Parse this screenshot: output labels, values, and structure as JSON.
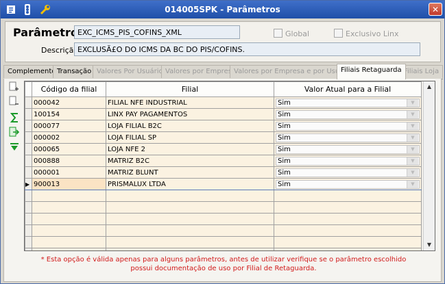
{
  "window": {
    "title": "014005SPK - Parâmetros",
    "close_label": "✕"
  },
  "toolbar": {
    "icons": [
      "menu-icon",
      "traffic-light-icon",
      "wrench-icon"
    ]
  },
  "form": {
    "parametro_label": "Parâmetro",
    "parametro_value": "EXC_ICMS_PIS_COFINS_XML",
    "global_label": "Global",
    "exclusivo_label": "Exclusivo Linx",
    "descricao_label": "Descrição",
    "descricao_value": "EXCLUSÃ£O DO ICMS DA BC DO PIS/COFINS."
  },
  "tabs": [
    {
      "label": "Complemento",
      "state": "normal"
    },
    {
      "label": "Transação",
      "state": "normal"
    },
    {
      "label": "Valores Por Usuários",
      "state": "disabled"
    },
    {
      "label": "Valores por Empresa",
      "state": "disabled"
    },
    {
      "label": "Valores por Empresa e por Usuário",
      "state": "disabled"
    },
    {
      "label": "Filiais Retaguarda",
      "state": "active"
    },
    {
      "label": "Filiais Loja",
      "state": "disabled"
    }
  ],
  "grid": {
    "columns": [
      "Código da filial",
      "Filial",
      "Valor Atual para a Filial"
    ],
    "rows": [
      {
        "codigo": "000042",
        "filial": "FILIAL NFE INDUSTRIAL",
        "valor": "Sim"
      },
      {
        "codigo": "100154",
        "filial": "LINX PAY PAGAMENTOS",
        "valor": "Sim"
      },
      {
        "codigo": "000077",
        "filial": "LOJA FILIAL B2C",
        "valor": "Sim"
      },
      {
        "codigo": "000002",
        "filial": "LOJA FILIAL SP",
        "valor": "Sim"
      },
      {
        "codigo": "000065",
        "filial": "LOJA NFE 2",
        "valor": "Sim"
      },
      {
        "codigo": "000888",
        "filial": "MATRIZ B2C",
        "valor": "Sim"
      },
      {
        "codigo": "000001",
        "filial": "MATRIZ BLUNT",
        "valor": "Sim"
      },
      {
        "codigo": "900013",
        "filial": "PRISMALUX LTDA",
        "valor": "Sim"
      }
    ],
    "selected_row": 7,
    "row_pointer": "▶"
  },
  "side_icons": [
    "page-add-icon",
    "page-remove-icon",
    "sum-icon",
    "export-icon",
    "collapse-icon"
  ],
  "note_line1": "* Esta opção é válida apenas para alguns parâmetros, antes de utilizar verifique se o parâmetro escolhido",
  "note_line2": "possui documentação de uso por Filial de Retaguarda.",
  "colors": {
    "titlebar": "#2a5bb8",
    "note": "#d11a1a",
    "cell": "#fbf2e1"
  }
}
